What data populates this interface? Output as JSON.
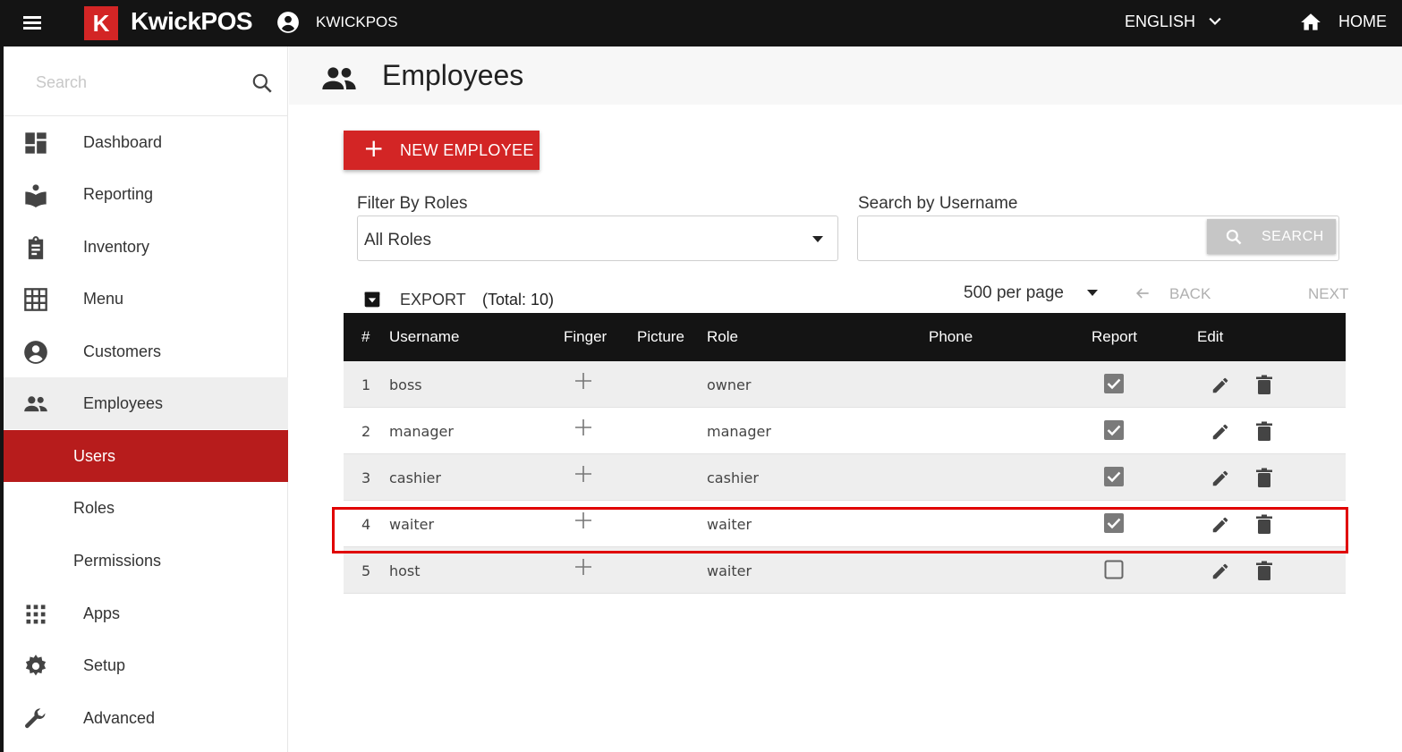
{
  "topbar": {
    "logo_letter": "K",
    "brand": "KwickPOS",
    "account": "KWICKPOS",
    "language": "ENGLISH",
    "home": "HOME"
  },
  "sidebar": {
    "search_placeholder": "Search",
    "items": [
      {
        "label": "Dashboard",
        "icon": "dashboard-icon"
      },
      {
        "label": "Reporting",
        "icon": "reporting-icon"
      },
      {
        "label": "Inventory",
        "icon": "clipboard-icon"
      },
      {
        "label": "Menu",
        "icon": "grid-icon"
      },
      {
        "label": "Customers",
        "icon": "account-circle-icon"
      },
      {
        "label": "Employees",
        "icon": "people-icon"
      }
    ],
    "sub_items": [
      {
        "label": "Users"
      },
      {
        "label": "Roles"
      },
      {
        "label": "Permissions"
      }
    ],
    "bottom_items": [
      {
        "label": "Apps",
        "icon": "apps-icon"
      },
      {
        "label": "Setup",
        "icon": "gear-icon"
      },
      {
        "label": "Advanced",
        "icon": "wrench-icon"
      }
    ]
  },
  "page": {
    "title": "Employees",
    "new_button": "NEW EMPLOYEE",
    "filter_label": "Filter By Roles",
    "filter_value": "All Roles",
    "search_label": "Search by Username",
    "search_button": "SEARCH",
    "export": "EXPORT",
    "total": "(Total: 10)",
    "per_page": "500 per page",
    "back": "BACK",
    "next": "NEXT"
  },
  "table": {
    "headers": {
      "num": "#",
      "username": "Username",
      "finger": "Finger",
      "picture": "Picture",
      "role": "Role",
      "phone": "Phone",
      "report": "Report",
      "edit": "Edit"
    },
    "rows": [
      {
        "num": "1",
        "username": "boss",
        "role": "owner",
        "report": true
      },
      {
        "num": "2",
        "username": "manager",
        "role": "manager",
        "report": true
      },
      {
        "num": "3",
        "username": "cashier",
        "role": "cashier",
        "report": true
      },
      {
        "num": "4",
        "username": "waiter",
        "role": "waiter",
        "report": true
      },
      {
        "num": "5",
        "username": "host",
        "role": "waiter",
        "report": false
      }
    ]
  },
  "colors": {
    "brand_red": "#d32525",
    "selected_red": "#b71c1c",
    "topbar": "#141414",
    "highlight": "#e00000"
  }
}
